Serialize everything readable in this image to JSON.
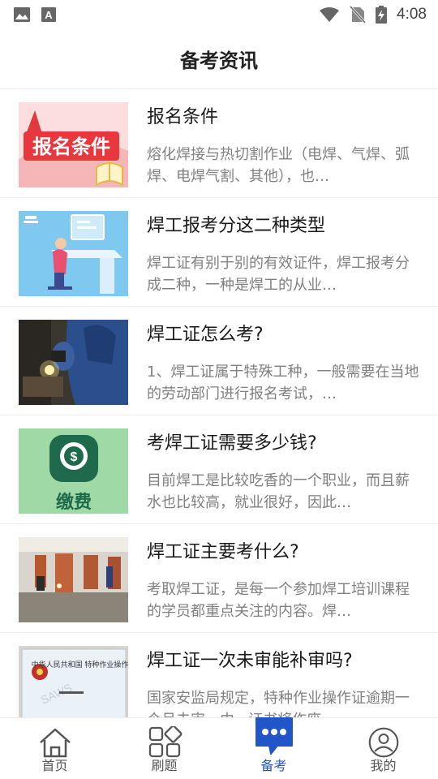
{
  "status": {
    "time": "4:08",
    "icons": [
      "image-icon",
      "a-keyboard-icon",
      "wifi-icon",
      "no-sim-icon",
      "battery-charging-icon"
    ]
  },
  "header": {
    "title": "备考资讯"
  },
  "articles": [
    {
      "title": "报名条件",
      "desc": "熔化焊接与热切割作业（电焊、气焊、弧焊、电焊气割、其他），也…",
      "thumb_text": "报名条件"
    },
    {
      "title": "焊工报考分这二种类型",
      "desc": "焊工证有别于别的有效证件，焊工报考分成二种，一种是焊工的从业…"
    },
    {
      "title": "焊工证怎么考?",
      "desc": "1、焊工证属于特殊工种，一般需要在当地的劳动部门进行报名考试，…"
    },
    {
      "title": "考焊工证需要多少钱?",
      "desc": "目前焊工是比较吃香的一个职业，而且薪水也比较高，就业很好，因此…",
      "thumb_text": "缴费"
    },
    {
      "title": "焊工证主要考什么?",
      "desc": "考取焊工证，是每一个参加焊工培训课程的学员都重点关注的内容。焊…"
    },
    {
      "title": "焊工证一次未审能补审吗?",
      "desc": "国家安监局规定，特种作业操作证逾期一个月未审，由...证书将作废",
      "thumb_text": "中华人民共和国 特种作业操作证",
      "thumb_text_2": "SAWS"
    }
  ],
  "tabbar": {
    "tabs": [
      {
        "label": "首页",
        "icon": "home-icon"
      },
      {
        "label": "刷题",
        "icon": "grid-icon"
      },
      {
        "label": "备考",
        "icon": "chat-bubble-icon",
        "active": true
      },
      {
        "label": "我的",
        "icon": "user-icon"
      }
    ],
    "active_color": "#2255c8"
  },
  "colors": {
    "accent": "#2255c8",
    "divider": "#ececec",
    "desc": "#808080"
  }
}
